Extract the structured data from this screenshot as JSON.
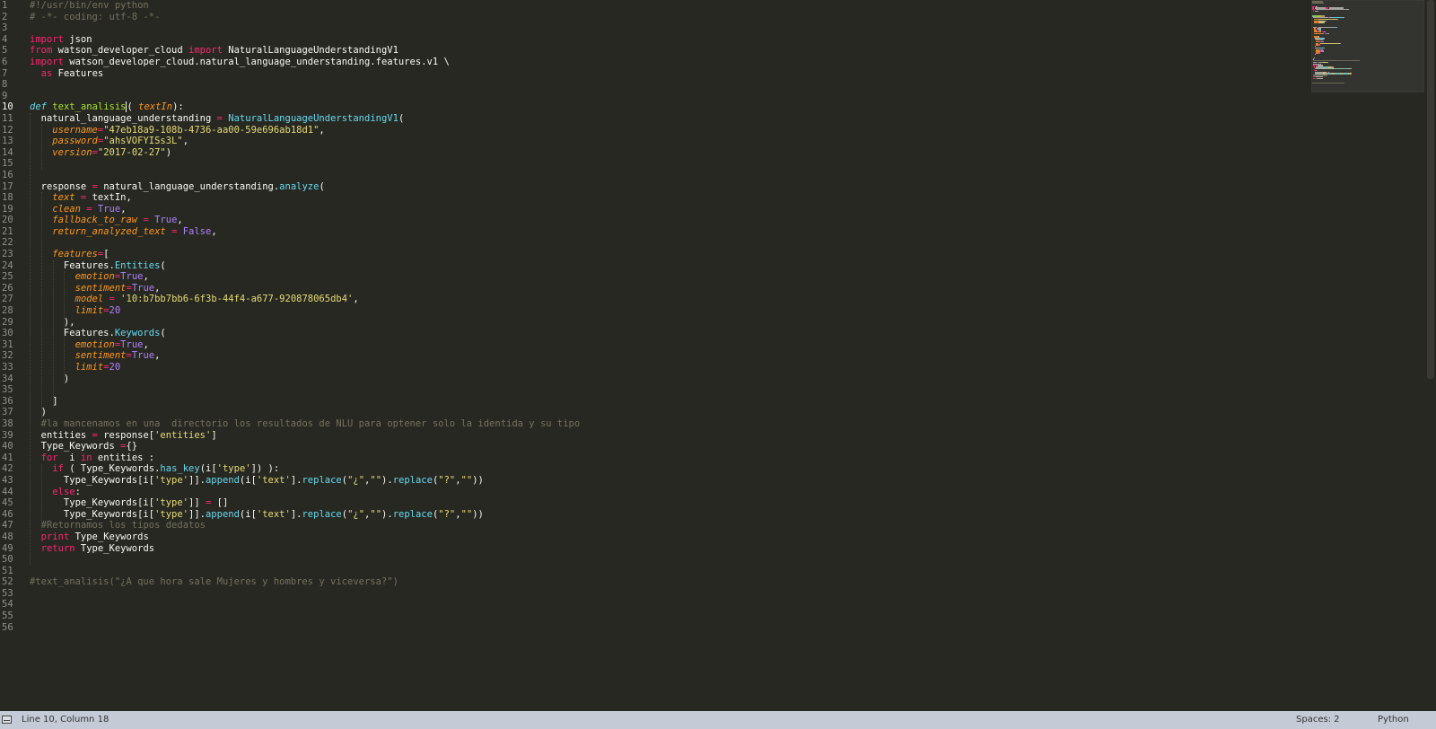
{
  "editor": {
    "current_line": 10,
    "lines": [
      [
        [
          "tk-cmt",
          "#!/usr/bin/env python"
        ]
      ],
      [
        [
          "tk-cmt",
          "# -*- coding: utf-8 -*-"
        ]
      ],
      [],
      [
        [
          "tk-kw",
          "import"
        ],
        [
          "tk-plain",
          " json"
        ]
      ],
      [
        [
          "tk-kw",
          "from"
        ],
        [
          "tk-plain",
          " watson_developer_cloud "
        ],
        [
          "tk-kw",
          "import"
        ],
        [
          "tk-plain",
          " NaturalLanguageUnderstandingV1"
        ]
      ],
      [
        [
          "tk-kw",
          "import"
        ],
        [
          "tk-plain",
          " watson_developer_cloud.natural_language_understanding.features.v1 \\"
        ]
      ],
      [
        [
          "tk-plain",
          "  "
        ],
        [
          "tk-kw",
          "as"
        ],
        [
          "tk-plain",
          " Features"
        ]
      ],
      [],
      [],
      [
        [
          "tk-def",
          "def"
        ],
        [
          "tk-plain",
          " "
        ],
        [
          "tk-fn",
          "text_analisis"
        ],
        [
          "caret",
          ""
        ],
        [
          "tk-plain",
          "( "
        ],
        [
          "tk-param",
          "textIn"
        ],
        [
          "tk-plain",
          "):"
        ]
      ],
      [
        [
          "tk-plain",
          "  natural_language_understanding "
        ],
        [
          "tk-op",
          "="
        ],
        [
          "tk-plain",
          " "
        ],
        [
          "tk-cls",
          "NaturalLanguageUnderstandingV1"
        ],
        [
          "tk-plain",
          "("
        ]
      ],
      [
        [
          "tk-plain",
          "    "
        ],
        [
          "tk-param",
          "username"
        ],
        [
          "tk-op",
          "="
        ],
        [
          "tk-str",
          "\"47eb18a9-108b-4736-aa00-59e696ab18d1\""
        ],
        [
          "tk-plain",
          ","
        ]
      ],
      [
        [
          "tk-plain",
          "    "
        ],
        [
          "tk-param",
          "password"
        ],
        [
          "tk-op",
          "="
        ],
        [
          "tk-str",
          "\"ahsVOFYISs3L\""
        ],
        [
          "tk-plain",
          ","
        ]
      ],
      [
        [
          "tk-plain",
          "    "
        ],
        [
          "tk-param",
          "version"
        ],
        [
          "tk-op",
          "="
        ],
        [
          "tk-str",
          "\"2017-02-27\""
        ],
        [
          "tk-plain",
          ")"
        ]
      ],
      [],
      [],
      [
        [
          "tk-plain",
          "  response "
        ],
        [
          "tk-op",
          "="
        ],
        [
          "tk-plain",
          " natural_language_understanding."
        ],
        [
          "tk-meth",
          "analyze"
        ],
        [
          "tk-plain",
          "("
        ]
      ],
      [
        [
          "tk-plain",
          "    "
        ],
        [
          "tk-param",
          "text"
        ],
        [
          "tk-plain",
          " "
        ],
        [
          "tk-op",
          "="
        ],
        [
          "tk-plain",
          " textIn,"
        ]
      ],
      [
        [
          "tk-plain",
          "    "
        ],
        [
          "tk-param",
          "clean"
        ],
        [
          "tk-plain",
          " "
        ],
        [
          "tk-op",
          "="
        ],
        [
          "tk-plain",
          " "
        ],
        [
          "tk-const",
          "True"
        ],
        [
          "tk-plain",
          ","
        ]
      ],
      [
        [
          "tk-plain",
          "    "
        ],
        [
          "tk-param",
          "fallback_to_raw"
        ],
        [
          "tk-plain",
          " "
        ],
        [
          "tk-op",
          "="
        ],
        [
          "tk-plain",
          " "
        ],
        [
          "tk-const",
          "True"
        ],
        [
          "tk-plain",
          ","
        ]
      ],
      [
        [
          "tk-plain",
          "    "
        ],
        [
          "tk-param",
          "return_analyzed_text"
        ],
        [
          "tk-plain",
          " "
        ],
        [
          "tk-op",
          "="
        ],
        [
          "tk-plain",
          " "
        ],
        [
          "tk-const",
          "False"
        ],
        [
          "tk-plain",
          ","
        ]
      ],
      [],
      [
        [
          "tk-plain",
          "    "
        ],
        [
          "tk-param",
          "features"
        ],
        [
          "tk-op",
          "="
        ],
        [
          "tk-plain",
          "["
        ]
      ],
      [
        [
          "tk-plain",
          "      Features."
        ],
        [
          "tk-meth",
          "Entities"
        ],
        [
          "tk-plain",
          "("
        ]
      ],
      [
        [
          "tk-plain",
          "        "
        ],
        [
          "tk-param",
          "emotion"
        ],
        [
          "tk-op",
          "="
        ],
        [
          "tk-const",
          "True"
        ],
        [
          "tk-plain",
          ","
        ]
      ],
      [
        [
          "tk-plain",
          "        "
        ],
        [
          "tk-param",
          "sentiment"
        ],
        [
          "tk-op",
          "="
        ],
        [
          "tk-const",
          "True"
        ],
        [
          "tk-plain",
          ","
        ]
      ],
      [
        [
          "tk-plain",
          "        "
        ],
        [
          "tk-param",
          "model"
        ],
        [
          "tk-plain",
          " "
        ],
        [
          "tk-op",
          "="
        ],
        [
          "tk-plain",
          " "
        ],
        [
          "tk-str",
          "'10:b7bb7bb6-6f3b-44f4-a677-920878065db4'"
        ],
        [
          "tk-plain",
          ","
        ]
      ],
      [
        [
          "tk-plain",
          "        "
        ],
        [
          "tk-param",
          "limit"
        ],
        [
          "tk-op",
          "="
        ],
        [
          "tk-num",
          "20"
        ]
      ],
      [
        [
          "tk-plain",
          "      ),"
        ]
      ],
      [
        [
          "tk-plain",
          "      Features."
        ],
        [
          "tk-meth",
          "Keywords"
        ],
        [
          "tk-plain",
          "("
        ]
      ],
      [
        [
          "tk-plain",
          "        "
        ],
        [
          "tk-param",
          "emotion"
        ],
        [
          "tk-op",
          "="
        ],
        [
          "tk-const",
          "True"
        ],
        [
          "tk-plain",
          ","
        ]
      ],
      [
        [
          "tk-plain",
          "        "
        ],
        [
          "tk-param",
          "sentiment"
        ],
        [
          "tk-op",
          "="
        ],
        [
          "tk-const",
          "True"
        ],
        [
          "tk-plain",
          ","
        ]
      ],
      [
        [
          "tk-plain",
          "        "
        ],
        [
          "tk-param",
          "limit"
        ],
        [
          "tk-op",
          "="
        ],
        [
          "tk-num",
          "20"
        ]
      ],
      [
        [
          "tk-plain",
          "      )"
        ]
      ],
      [],
      [
        [
          "tk-plain",
          "    ]"
        ]
      ],
      [
        [
          "tk-plain",
          "  )"
        ]
      ],
      [
        [
          "tk-plain",
          "  "
        ],
        [
          "tk-cmt",
          "#la mancenamos en una  directorio los resultados de NLU para optener solo la identida y su tipo"
        ]
      ],
      [
        [
          "tk-plain",
          "  entities "
        ],
        [
          "tk-op",
          "="
        ],
        [
          "tk-plain",
          " response["
        ],
        [
          "tk-str",
          "'entities'"
        ],
        [
          "tk-plain",
          "]"
        ]
      ],
      [
        [
          "tk-plain",
          "  Type_Keywords "
        ],
        [
          "tk-op",
          "="
        ],
        [
          "tk-plain",
          "{}"
        ]
      ],
      [
        [
          "tk-plain",
          "  "
        ],
        [
          "tk-kw",
          "for"
        ],
        [
          "tk-plain",
          "  i "
        ],
        [
          "tk-kw",
          "in"
        ],
        [
          "tk-plain",
          " entities :"
        ]
      ],
      [
        [
          "tk-plain",
          "    "
        ],
        [
          "tk-kw",
          "if"
        ],
        [
          "tk-plain",
          " ( Type_Keywords."
        ],
        [
          "tk-meth",
          "has_key"
        ],
        [
          "tk-plain",
          "(i["
        ],
        [
          "tk-str",
          "'type'"
        ],
        [
          "tk-plain",
          "]) ):"
        ]
      ],
      [
        [
          "tk-plain",
          "      Type_Keywords[i["
        ],
        [
          "tk-str",
          "'type'"
        ],
        [
          "tk-plain",
          "]]."
        ],
        [
          "tk-meth",
          "append"
        ],
        [
          "tk-plain",
          "(i["
        ],
        [
          "tk-str",
          "'text'"
        ],
        [
          "tk-plain",
          "]."
        ],
        [
          "tk-meth",
          "replace"
        ],
        [
          "tk-plain",
          "("
        ],
        [
          "tk-str",
          "\"¿\""
        ],
        [
          "tk-plain",
          ","
        ],
        [
          "tk-str",
          "\"\""
        ],
        [
          "tk-plain",
          ")."
        ],
        [
          "tk-meth",
          "replace"
        ],
        [
          "tk-plain",
          "("
        ],
        [
          "tk-str",
          "\"?\""
        ],
        [
          "tk-plain",
          ","
        ],
        [
          "tk-str",
          "\"\""
        ],
        [
          "tk-plain",
          "))"
        ]
      ],
      [
        [
          "tk-plain",
          "    "
        ],
        [
          "tk-kw",
          "else"
        ],
        [
          "tk-plain",
          ":"
        ]
      ],
      [
        [
          "tk-plain",
          "      Type_Keywords[i["
        ],
        [
          "tk-str",
          "'type'"
        ],
        [
          "tk-plain",
          "]] "
        ],
        [
          "tk-op",
          "="
        ],
        [
          "tk-plain",
          " []"
        ]
      ],
      [
        [
          "tk-plain",
          "      Type_Keywords[i["
        ],
        [
          "tk-str",
          "'type'"
        ],
        [
          "tk-plain",
          "]]."
        ],
        [
          "tk-meth",
          "append"
        ],
        [
          "tk-plain",
          "(i["
        ],
        [
          "tk-str",
          "'text'"
        ],
        [
          "tk-plain",
          "]."
        ],
        [
          "tk-meth",
          "replace"
        ],
        [
          "tk-plain",
          "("
        ],
        [
          "tk-str",
          "\"¿\""
        ],
        [
          "tk-plain",
          ","
        ],
        [
          "tk-str",
          "\"\""
        ],
        [
          "tk-plain",
          ")."
        ],
        [
          "tk-meth",
          "replace"
        ],
        [
          "tk-plain",
          "("
        ],
        [
          "tk-str",
          "\"?\""
        ],
        [
          "tk-plain",
          ","
        ],
        [
          "tk-str",
          "\"\""
        ],
        [
          "tk-plain",
          "))"
        ]
      ],
      [
        [
          "tk-plain",
          "  "
        ],
        [
          "tk-cmt",
          "#Retornamos los tipos dedatos"
        ]
      ],
      [
        [
          "tk-plain",
          "  "
        ],
        [
          "tk-kw",
          "print"
        ],
        [
          "tk-plain",
          " Type_Keywords"
        ]
      ],
      [
        [
          "tk-plain",
          "  "
        ],
        [
          "tk-kw",
          "return"
        ],
        [
          "tk-plain",
          " Type_Keywords"
        ]
      ],
      [],
      [],
      [
        [
          "tk-cmt",
          "#text_analisis(\"¿A que hora sale Mujeres y hombres y viceversa?\")"
        ]
      ],
      [],
      [],
      [],
      []
    ]
  },
  "status": {
    "position": "Line 10, Column 18",
    "spaces": "Spaces: 2",
    "syntax": "Python"
  }
}
